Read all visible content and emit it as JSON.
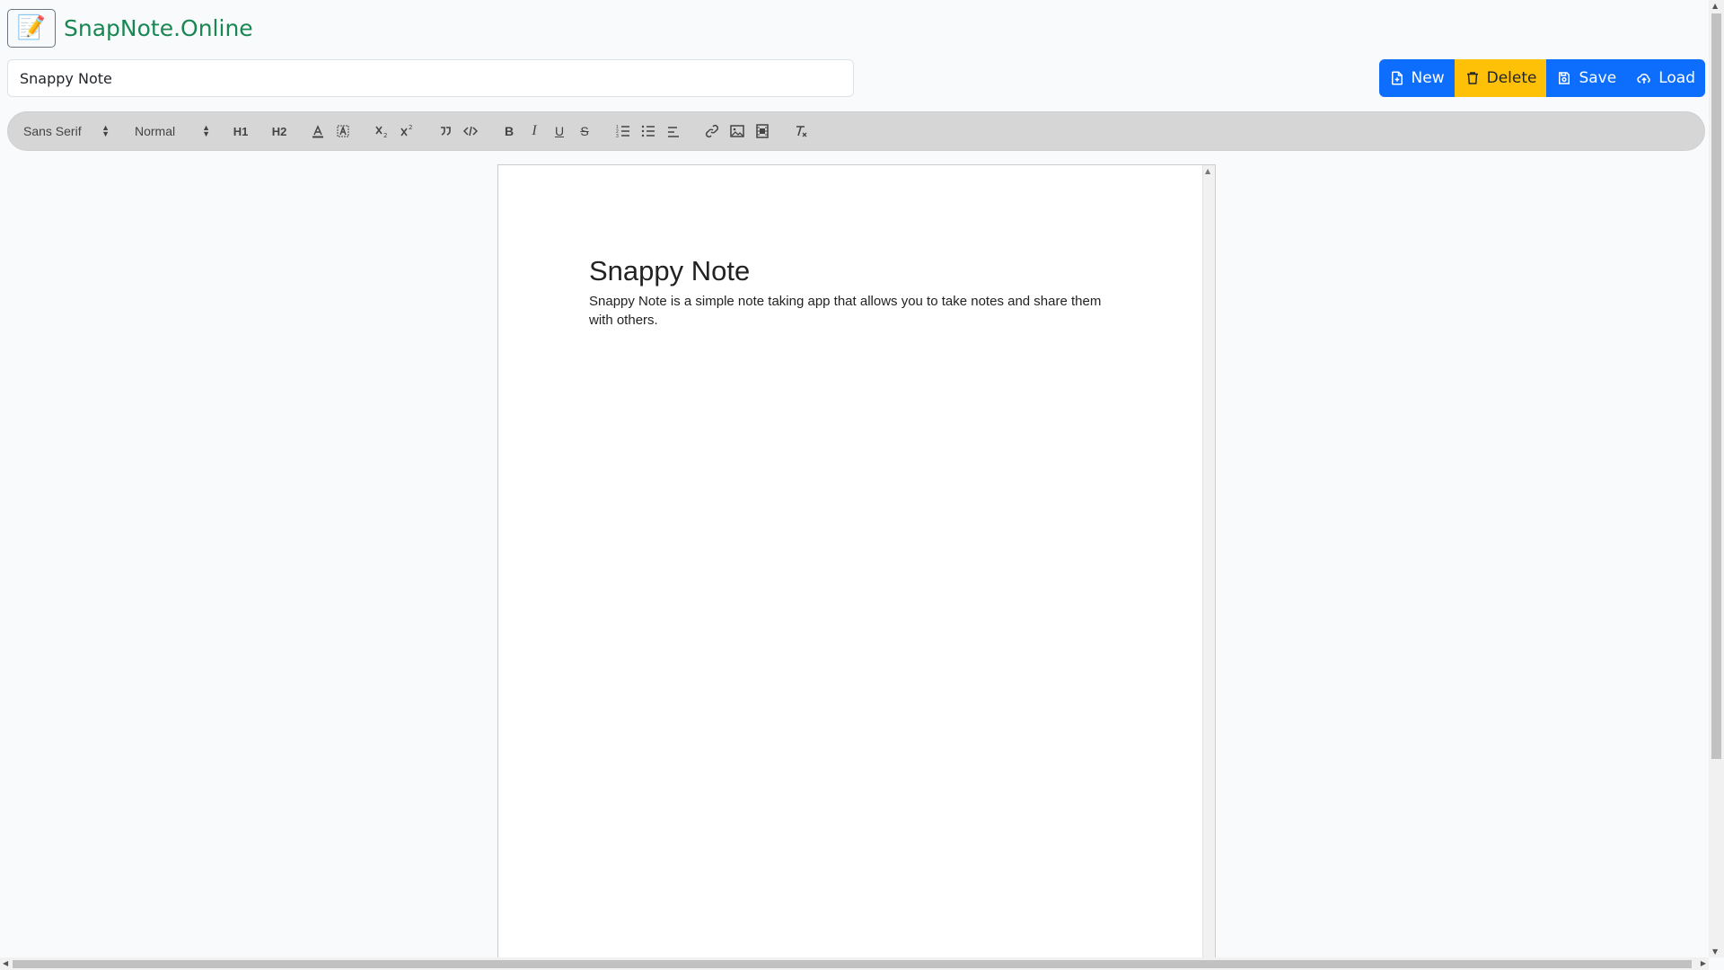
{
  "header": {
    "logo_emoji": "📝",
    "brand": "SnapNote.Online"
  },
  "note_title": {
    "value": "Snappy Note"
  },
  "actions": {
    "new": {
      "label": "New",
      "icon": "file-plus-icon",
      "color": "#0d6efd"
    },
    "delete": {
      "label": "Delete",
      "icon": "trash-icon",
      "color": "#ffc107"
    },
    "save": {
      "label": "Save",
      "icon": "save-icon",
      "color": "#0d6efd"
    },
    "load": {
      "label": "Load",
      "icon": "cloud-upload-icon",
      "color": "#0d6efd"
    }
  },
  "toolbar": {
    "font": "Sans Serif",
    "size": "Normal",
    "h1": "H1",
    "h2": "H2",
    "bold": "B",
    "italic": "I",
    "underline": "U",
    "strike": "S"
  },
  "document": {
    "heading": "Snappy Note",
    "body": "Snappy Note is a simple note taking app that allows you to take notes and share them with others."
  }
}
